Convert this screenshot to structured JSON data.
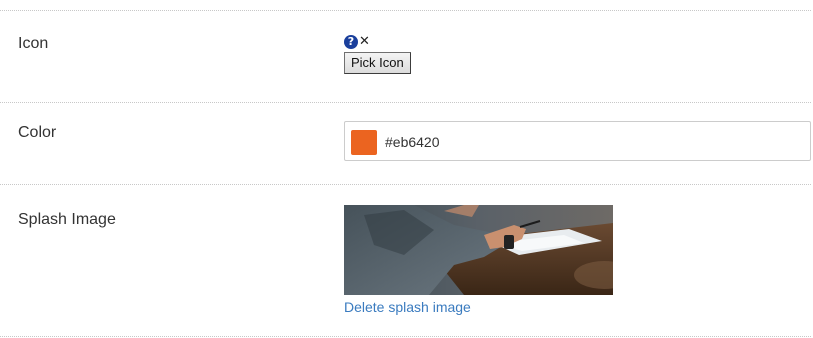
{
  "fields": {
    "icon": {
      "label": "Icon",
      "help_glyph": "?",
      "clear_glyph": "✕",
      "pick_button_label": "Pick Icon"
    },
    "color": {
      "label": "Color",
      "value": "#eb6420",
      "swatch_color": "#eb6420"
    },
    "splash": {
      "label": "Splash Image",
      "delete_link_label": "Delete splash image"
    }
  },
  "icons": {
    "help": "question-circle-icon",
    "clear": "close-icon"
  },
  "colors": {
    "link": "#3a7bbf",
    "help_icon": "#1a3f9c",
    "divider": "#c8c8c8"
  }
}
